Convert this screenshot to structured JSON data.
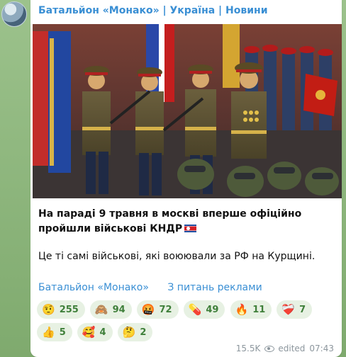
{
  "channel": {
    "name": "Батальйон «Монако» | Україна | Новини"
  },
  "post": {
    "title": "На параді 9 травня в москві вперше офіційно пройшли військові КНДР",
    "body": "Це ті самі військові, які воюювали за РФ на Курщині."
  },
  "links": [
    {
      "label": "Батальйон «Монако»"
    },
    {
      "label": "З питань реклами"
    }
  ],
  "reactions": [
    {
      "icon": "thinking-face-icon",
      "emoji": "🤨",
      "count": "255"
    },
    {
      "icon": "see-no-evil-monkey-icon",
      "emoji": "🙈",
      "count": "94"
    },
    {
      "icon": "angry-face-icon",
      "emoji": "🤬",
      "count": "72"
    },
    {
      "icon": "pill-icon",
      "emoji": "💊",
      "count": "49"
    },
    {
      "icon": "fire-icon",
      "emoji": "🔥",
      "count": "11"
    },
    {
      "icon": "broken-heart-icon",
      "emoji": "❤️‍🩹",
      "count": "7"
    },
    {
      "icon": "thumbs-up-icon",
      "emoji": "👍",
      "count": "5"
    },
    {
      "icon": "hearts-face-icon",
      "emoji": "🥰",
      "count": "4"
    },
    {
      "icon": "thinking-icon",
      "emoji": "🤔",
      "count": "2"
    }
  ],
  "meta": {
    "views": "15.5K",
    "edited": "edited",
    "time": "07:43"
  },
  "colors": {
    "accent": "#3a8fd4",
    "reaction_bg": "#e7f1e3",
    "reaction_text": "#3f7f3a",
    "chat_bg": "#88b07a"
  }
}
